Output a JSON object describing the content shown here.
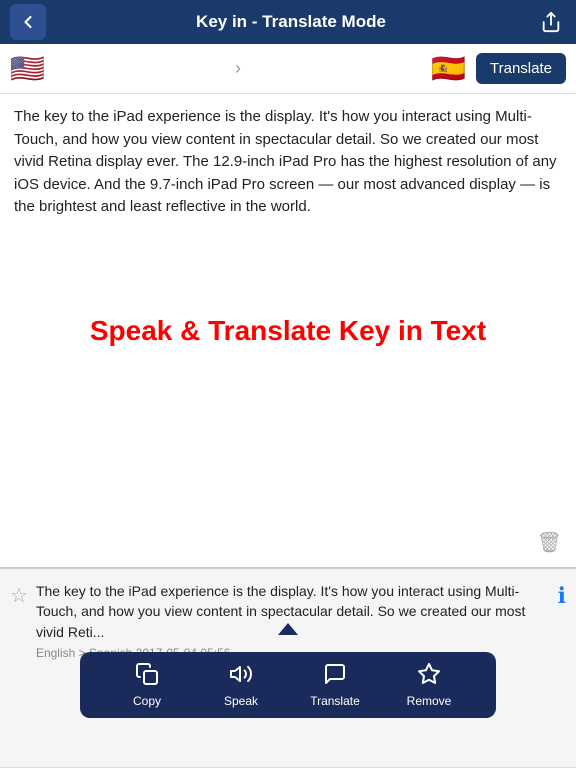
{
  "header": {
    "title": "Key in - Translate Mode",
    "back_label": "back",
    "share_label": "share"
  },
  "flag_bar": {
    "source_flag": "🇺🇸",
    "arrow": "›",
    "target_flag": "🇪🇸",
    "translate_button": "Translate"
  },
  "main": {
    "input_text": "The key to the iPad experience is the display. It's how you interact using Multi-Touch, and how you view content in spectacular detail. So we created our most vivid Retina display ever. The 12.9-inch iPad Pro has the highest resolution of any iOS device. And the 9.7-inch iPad Pro screen — our most advanced display — is the brightest and least reflective in the world.",
    "watermark": "Speak & Translate Key in Text",
    "trash_label": "delete"
  },
  "history": {
    "star_label": "favorite",
    "text": "The key to the iPad experience is the display. It's how you interact using Multi-Touch, and how you view content in spectacular detail. So we created our most vivid Reti...",
    "meta": "English > Spanish 2017-05-04 05:56",
    "info_label": "info"
  },
  "toolbar": {
    "items": [
      {
        "id": "copy",
        "icon": "📋",
        "label": "Copy"
      },
      {
        "id": "speak",
        "icon": "🔊",
        "label": "Speak"
      },
      {
        "id": "translate",
        "icon": "💬",
        "label": "Translate"
      },
      {
        "id": "remove",
        "icon": "☆",
        "label": "Remove"
      }
    ]
  }
}
